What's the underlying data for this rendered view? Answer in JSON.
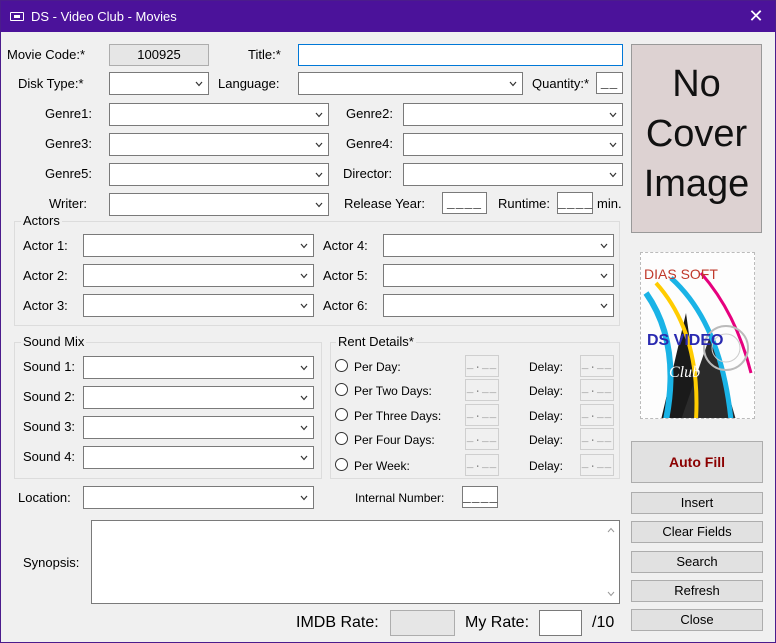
{
  "window": {
    "title": "DS - Video Club - Movies",
    "close_glyph": "✕"
  },
  "labels": {
    "movie_code": "Movie Code:*",
    "title": "Title:*",
    "disk_type": "Disk Type:*",
    "language": "Language:",
    "quantity": "Quantity:*",
    "genre1": "Genre1:",
    "genre2": "Genre2:",
    "genre3": "Genre3:",
    "genre4": "Genre4:",
    "genre5": "Genre5:",
    "director": "Director:",
    "writer": "Writer:",
    "release_year": "Release Year:",
    "runtime": "Runtime:",
    "min": "min.",
    "location": "Location:",
    "internal_number": "Internal Number:",
    "synopsis": "Synopsis:",
    "imdb_rate": "IMDB Rate:",
    "my_rate": "My Rate:",
    "of_ten": "/10"
  },
  "fields": {
    "movie_code_value": "100925",
    "title_value": "",
    "quantity_mask": "__",
    "release_year_mask": "____",
    "runtime_mask": "____",
    "internal_number_mask": "____",
    "imdb_rate_value": "",
    "my_rate_value": ""
  },
  "actors": {
    "group_title": "Actors",
    "labels": [
      "Actor 1:",
      "Actor 2:",
      "Actor 3:",
      "Actor 4:",
      "Actor 5:",
      "Actor 6:"
    ]
  },
  "sound_mix": {
    "group_title": "Sound Mix",
    "labels": [
      "Sound 1:",
      "Sound 2:",
      "Sound 3:",
      "Sound 4:"
    ]
  },
  "rent_details": {
    "group_title": "Rent Details*",
    "options": [
      "Per Day:",
      "Per Two Days:",
      "Per Three Days:",
      "Per Four Days:",
      "Per Week:"
    ],
    "price_mask": "_.__",
    "delay_label": "Delay:",
    "delay_mask": "_.__"
  },
  "cover": {
    "line1": "No",
    "line2": "Cover",
    "line3": "Image"
  },
  "logo": {
    "top_text": "DIAS SOFT",
    "mid_text": "DS VIDEO",
    "bottom_text": "Club"
  },
  "buttons": {
    "auto_fill": "Auto Fill",
    "insert": "Insert",
    "clear_fields": "Clear Fields",
    "search": "Search",
    "refresh": "Refresh",
    "close": "Close"
  },
  "icons": {
    "dropdown": "chevron-down-icon",
    "app": "app-icon"
  }
}
